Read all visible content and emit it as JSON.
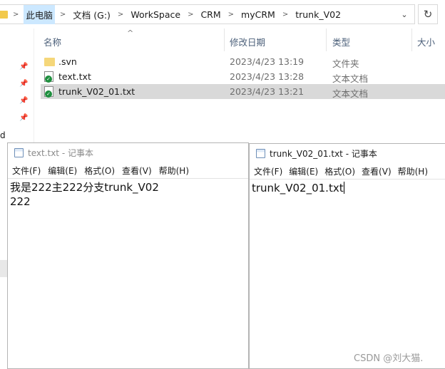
{
  "explorer": {
    "breadcrumbs": [
      "此电脑",
      "文档 (G:)",
      "WorkSpace",
      "CRM",
      "myCRM",
      "trunk_V02"
    ],
    "left_fragment": "d",
    "columns": {
      "name": "名称",
      "date": "修改日期",
      "type": "类型",
      "size": "大小"
    },
    "files": [
      {
        "name": ".svn",
        "date": "2023/4/23 13:19",
        "type": "文件夹",
        "icon": "folder-icon"
      },
      {
        "name": "text.txt",
        "date": "2023/4/23 13:28",
        "type": "文本文档",
        "icon": "text-file-icon"
      },
      {
        "name": "trunk_V02_01.txt",
        "date": "2023/4/23 13:21",
        "type": "文本文档",
        "icon": "text-file-icon",
        "selected": true
      }
    ]
  },
  "notepad_left": {
    "title": "text.txt - 记事本",
    "menu": [
      "文件(F)",
      "编辑(E)",
      "格式(O)",
      "查看(V)",
      "帮助(H)"
    ],
    "lines": [
      "我是222主222分支trunk_V02",
      "222"
    ]
  },
  "notepad_right": {
    "title": "trunk_V02_01.txt - 记事本",
    "menu": [
      "文件(F)",
      "编辑(E)",
      "格式(O)",
      "查看(V)",
      "帮助(H)"
    ],
    "lines": [
      "trunk_V02_01.txt"
    ]
  },
  "watermark": "CSDN @刘大猫.",
  "colors": {
    "selection": "#d9d9d9",
    "breadcrumb_active": "#cce8ff",
    "folder": "#f5d77a",
    "badge": "#1e8f3e"
  }
}
